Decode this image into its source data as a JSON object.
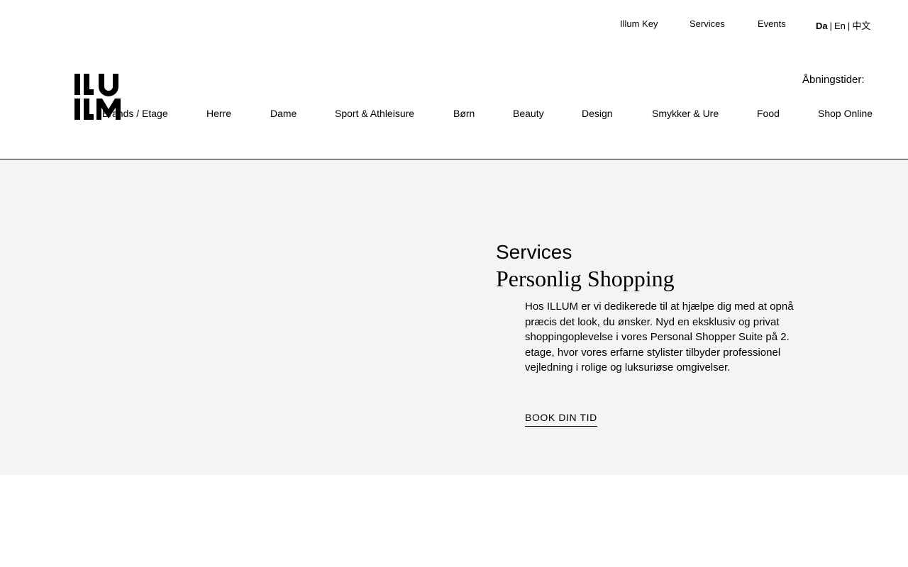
{
  "topnav": {
    "illum_key": "Illum Key",
    "services": "Services",
    "events": "Events"
  },
  "language": {
    "da": "Da",
    "separator": "|",
    "en": "En",
    "zh": "中文",
    "active": "Da"
  },
  "logo": {
    "alt": "ILLUM",
    "icon": "illum-logo-icon"
  },
  "opening_hours": {
    "label": "Åbningstider:"
  },
  "mainnav": {
    "items": [
      "Brands / Etage",
      "Herre",
      "Dame",
      "Sport & Athleisure",
      "Børn",
      "Beauty",
      "Design",
      "Smykker & Ure",
      "Food",
      "Shop Online"
    ]
  },
  "hero": {
    "eyebrow": "Services",
    "title": "Personlig Shopping",
    "description": "Hos ILLUM er vi dedikerede til at hjælpe dig med at opnå præcis det look, du ønsker. Nyd en eksklusiv og privat shoppingoplevelse i vores Personal Shopper Suite på 2. etage, hvor vores erfarne stylister tilbyder professionel vejledning i rolige og luksuriøse omgivelser.",
    "cta": "BOOK DIN TID"
  },
  "colors": {
    "text": "#000000",
    "background": "#ffffff",
    "hero_background": "#f5f4f2",
    "divider": "#000000"
  }
}
